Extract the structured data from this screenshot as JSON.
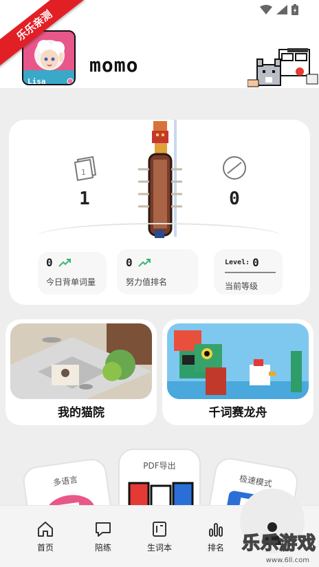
{
  "watermark": {
    "ribbon_text": "乐乐亲测",
    "site_text": "乐乐游戏",
    "site_url": "www.6ll.com"
  },
  "header": {
    "username": "momo",
    "avatar_label": "Lisa"
  },
  "stats": {
    "left_value": "1",
    "right_value": "0",
    "today_words": {
      "value": "0",
      "label": "今日背单词量"
    },
    "effort_rank": {
      "value": "0",
      "label": "努力值排名"
    },
    "level": {
      "prefix": "Level:",
      "value": "0",
      "label": "当前等级"
    }
  },
  "features": [
    {
      "label": "我的猫院"
    },
    {
      "label": "千词赛龙舟"
    }
  ],
  "tools": [
    {
      "label": "多语言"
    },
    {
      "label": "PDF导出"
    },
    {
      "label": "极速模式"
    }
  ],
  "tabs": [
    {
      "label": "首页"
    },
    {
      "label": "陪练"
    },
    {
      "label": "生词本"
    },
    {
      "label": "排名"
    }
  ],
  "colors": {
    "accent_green": "#3cb371",
    "ribbon_red": "#e31f26",
    "card_bg": "#ffffff",
    "page_bg": "#eeeeee"
  }
}
